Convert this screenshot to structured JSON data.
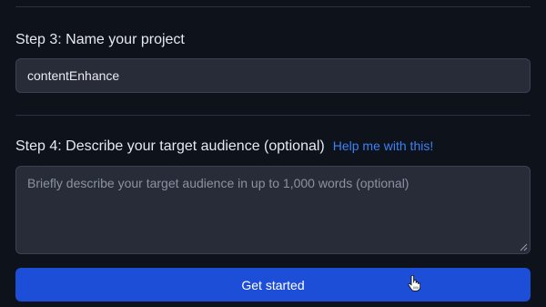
{
  "step3": {
    "label": "Step 3: Name your project",
    "project_name_value": "contentEnhance"
  },
  "step4": {
    "label": "Step 4: Describe your target audience (optional)",
    "help_link": "Help me with this!",
    "audience_placeholder": "Briefly describe your target audience in up to 1,000 words (optional)",
    "audience_value": ""
  },
  "submit": {
    "label": "Get started"
  },
  "colors": {
    "background": "#0e121b",
    "field_background": "#272c38",
    "accent_link": "#3b82f6",
    "button": "#1d4ed8"
  },
  "icons": {
    "pointer_cursor": "hand-pointer-icon",
    "textarea_resize": "resize-grip-icon"
  }
}
